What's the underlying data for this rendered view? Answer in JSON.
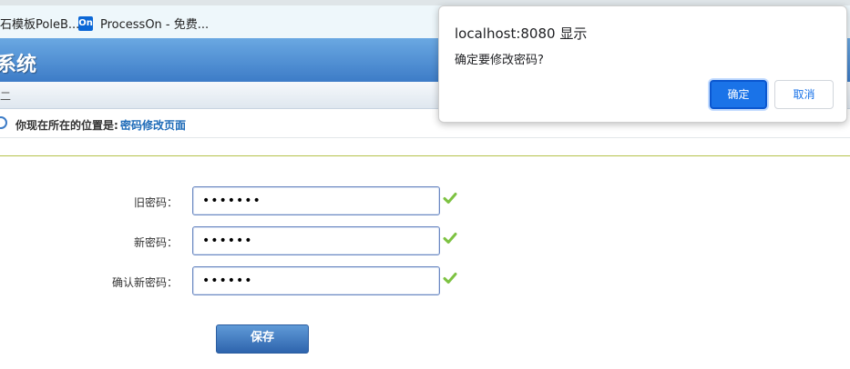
{
  "bookmarks": {
    "item1": "石模板PoleB...",
    "item2_icon": "On",
    "item2": "ProcessOn - 免费..."
  },
  "header": {
    "title": "系统"
  },
  "subbar": {
    "text": "二"
  },
  "breadcrumb": {
    "label": "你现在所在的位置是:",
    "current": "密码修改页面"
  },
  "form": {
    "old_label": "旧密码：",
    "old_value": "•••••••",
    "new_label": "新密码：",
    "new_value": "••••••",
    "confirm_label": "确认新密码：",
    "confirm_value": "••••••",
    "save_label": "保存"
  },
  "dialog": {
    "title": "localhost:8080 显示",
    "message": "确定要修改密码?",
    "ok_label": "确定",
    "cancel_label": "取消"
  },
  "colors": {
    "header": "#3d7cc7",
    "accent_link": "#1e6bb8",
    "divider": "#b5c24b",
    "check": "#7dc242",
    "dialog_primary": "#1a73e8"
  },
  "icons": {
    "check": "checkmark-icon",
    "location": "location-icon"
  }
}
